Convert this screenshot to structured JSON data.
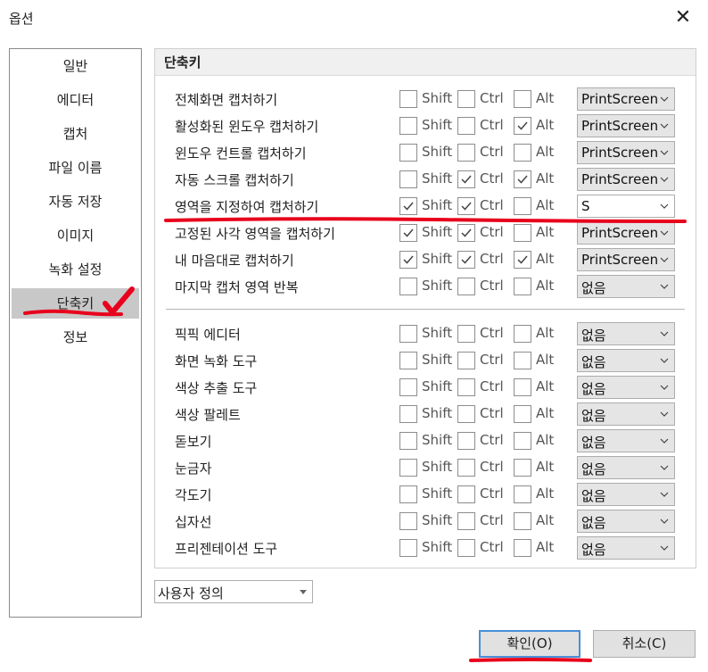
{
  "window": {
    "title": "옵션",
    "close_icon": "close-icon"
  },
  "sidebar": {
    "items": [
      {
        "label": "일반"
      },
      {
        "label": "에디터"
      },
      {
        "label": "캡처"
      },
      {
        "label": "파일 이름"
      },
      {
        "label": "자동 저장"
      },
      {
        "label": "이미지"
      },
      {
        "label": "녹화 설정"
      },
      {
        "label": "단축키",
        "active": true
      },
      {
        "label": "정보"
      }
    ]
  },
  "panel": {
    "header": "단축키",
    "modifier_labels": {
      "shift": "Shift",
      "ctrl": "Ctrl",
      "alt": "Alt"
    },
    "capture_rows": [
      {
        "label": "전체화면 캡처하기",
        "shift": false,
        "ctrl": false,
        "alt": false,
        "key": "PrintScreen"
      },
      {
        "label": "활성화된 윈도우 캡처하기",
        "shift": false,
        "ctrl": false,
        "alt": true,
        "key": "PrintScreen"
      },
      {
        "label": "윈도우 컨트롤 캡처하기",
        "shift": false,
        "ctrl": false,
        "alt": false,
        "key": "PrintScreen"
      },
      {
        "label": "자동 스크롤 캡처하기",
        "shift": false,
        "ctrl": true,
        "alt": true,
        "key": "PrintScreen"
      },
      {
        "label": "영역을 지정하여 캡처하기",
        "shift": true,
        "ctrl": true,
        "alt": false,
        "key": "S"
      },
      {
        "label": "고정된 사각 영역을 캡처하기",
        "shift": true,
        "ctrl": true,
        "alt": false,
        "key": "PrintScreen"
      },
      {
        "label": "내 마음대로 캡처하기",
        "shift": true,
        "ctrl": true,
        "alt": true,
        "key": "PrintScreen"
      },
      {
        "label": "마지막 캡처 영역 반복",
        "shift": false,
        "ctrl": false,
        "alt": false,
        "key": "없음"
      }
    ],
    "tool_rows": [
      {
        "label": "픽픽 에디터",
        "shift": false,
        "ctrl": false,
        "alt": false,
        "key": "없음"
      },
      {
        "label": "화면 녹화 도구",
        "shift": false,
        "ctrl": false,
        "alt": false,
        "key": "없음"
      },
      {
        "label": "색상 추출 도구",
        "shift": false,
        "ctrl": false,
        "alt": false,
        "key": "없음"
      },
      {
        "label": "색상 팔레트",
        "shift": false,
        "ctrl": false,
        "alt": false,
        "key": "없음"
      },
      {
        "label": "돋보기",
        "shift": false,
        "ctrl": false,
        "alt": false,
        "key": "없음"
      },
      {
        "label": "눈금자",
        "shift": false,
        "ctrl": false,
        "alt": false,
        "key": "없음"
      },
      {
        "label": "각도기",
        "shift": false,
        "ctrl": false,
        "alt": false,
        "key": "없음"
      },
      {
        "label": "십자선",
        "shift": false,
        "ctrl": false,
        "alt": false,
        "key": "없음"
      },
      {
        "label": "프리젠테이션 도구",
        "shift": false,
        "ctrl": false,
        "alt": false,
        "key": "없음"
      }
    ]
  },
  "preset": {
    "value": "사용자 정의"
  },
  "buttons": {
    "ok": "확인(O)",
    "cancel": "취소(C)"
  },
  "colors": {
    "annotation_red": "#e8001c",
    "active_item": "#c8c8c8",
    "focus_blue": "#4a8fd8"
  },
  "annotations": {
    "check_icon": "red-checkmark-icon"
  }
}
